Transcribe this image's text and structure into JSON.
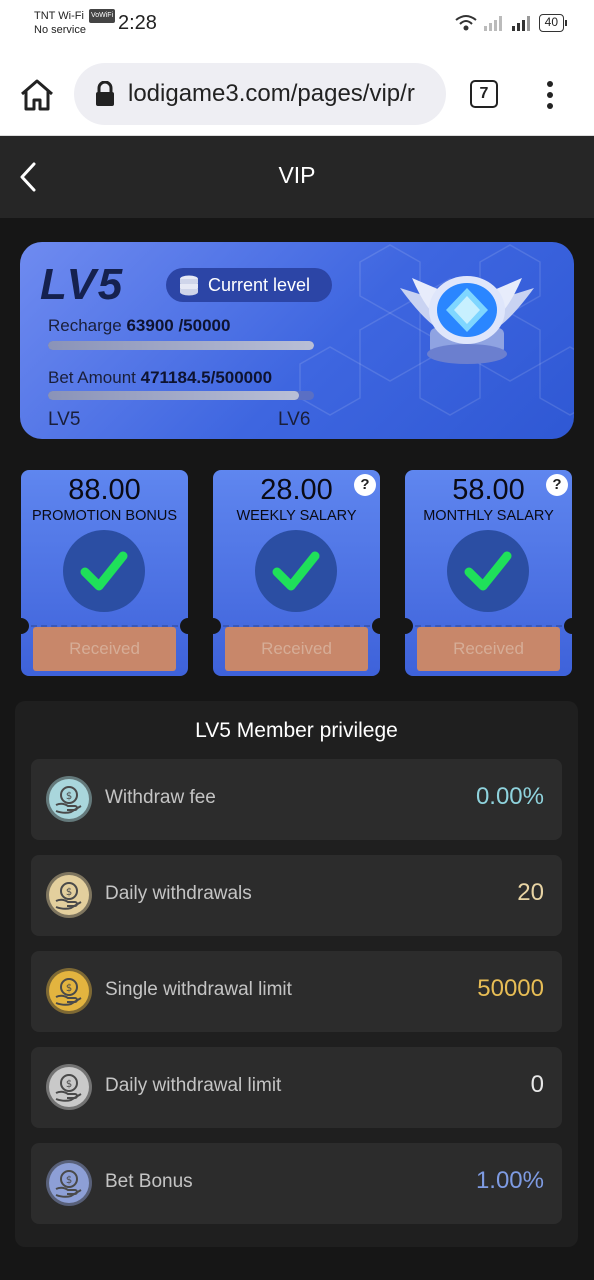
{
  "status_bar": {
    "carrier": "TNT Wi-Fi",
    "carrier_tag": "VoWiFi",
    "service": "No service",
    "time": "2:28",
    "battery": "40"
  },
  "browser": {
    "url": "lodigame3.com/pages/vip/r",
    "tab_count": "7"
  },
  "header": {
    "title": "VIP"
  },
  "level_card": {
    "level": "LV5",
    "current_label": "Current level",
    "recharge_label": "Recharge",
    "recharge_value": "63900 /50000",
    "recharge_progress": 1.0,
    "bet_label": "Bet Amount",
    "bet_value": "471184.5/500000",
    "bet_progress": 0.942,
    "from_level": "LV5",
    "to_level": "LV6"
  },
  "rewards": [
    {
      "amount": "88.00",
      "label": "PROMOTION BONUS",
      "button": "Received",
      "help": false
    },
    {
      "amount": "28.00",
      "label": "WEEKLY SALARY",
      "button": "Received",
      "help": true
    },
    {
      "amount": "58.00",
      "label": "MONTHLY SALARY",
      "button": "Received",
      "help": true
    }
  ],
  "privileges": {
    "title": "LV5 Member privilege",
    "items": [
      {
        "label": "Withdraw fee",
        "value": "0.00%",
        "color": "#8fd3dd",
        "icon": "coin-hand-icon",
        "coin": "#a9d6dc"
      },
      {
        "label": "Daily withdrawals",
        "value": "20",
        "color": "#e8d4a4",
        "icon": "coin-hand-icon",
        "coin": "#e3cf9d"
      },
      {
        "label": "Single withdrawal limit",
        "value": "50000",
        "color": "#e7bd55",
        "icon": "coin-hand-icon",
        "coin": "#e3b43f"
      },
      {
        "label": "Daily withdrawal limit",
        "value": "0",
        "color": "#e8e8e8",
        "icon": "coin-hand-icon",
        "coin": "#c9c9c9"
      },
      {
        "label": "Bet Bonus",
        "value": "1.00%",
        "color": "#7e9be3",
        "icon": "coin-hand-icon",
        "coin": "#8d9fd6"
      }
    ]
  }
}
